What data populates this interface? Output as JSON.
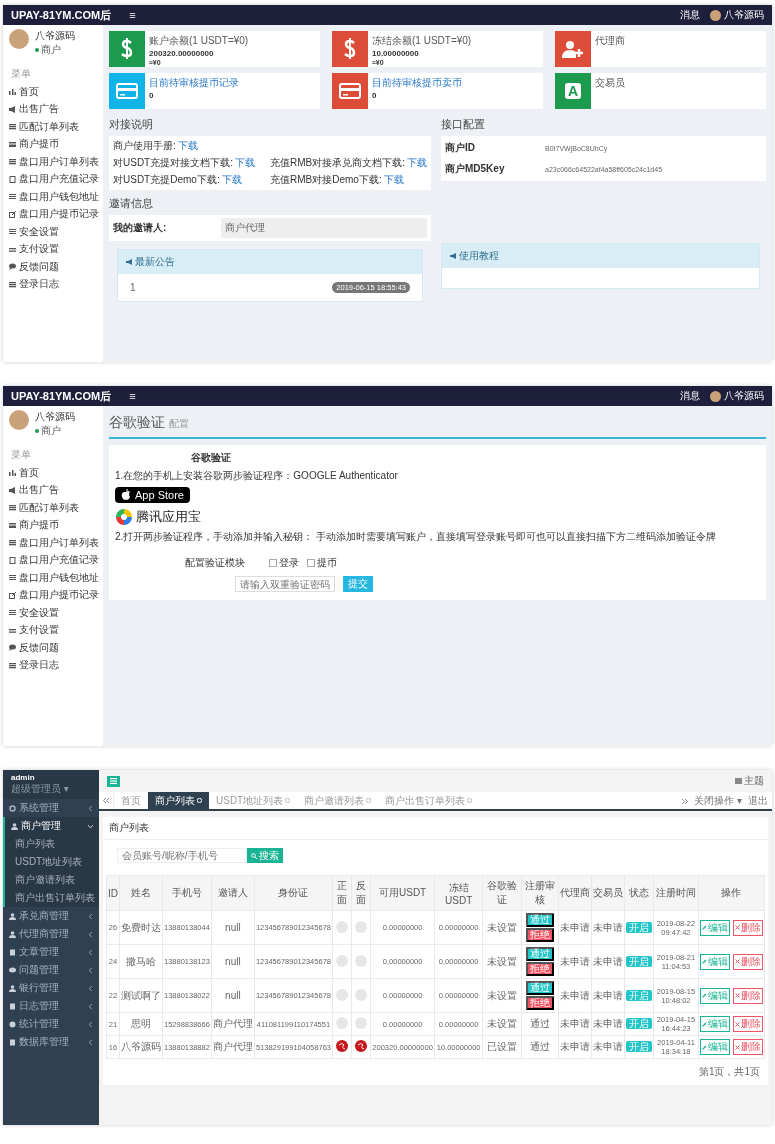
{
  "dashboard": {
    "topbar": {
      "brand": "UPAY-81YM.COM后",
      "menu_glyph": "≡",
      "messages": "消息",
      "user": "八爷源码"
    },
    "sidebar": {
      "user_name": "八爷源码",
      "user_role": "商户",
      "section": "菜单",
      "items": [
        {
          "label": "首页"
        },
        {
          "label": "出售广告"
        },
        {
          "label": "匹配订单列表"
        },
        {
          "label": "商户提币"
        },
        {
          "label": "盘口用户订单列表"
        },
        {
          "label": "盘口用户充值记录"
        },
        {
          "label": "盘口用户钱包地址"
        },
        {
          "label": "盘口用户提币记录"
        },
        {
          "label": "安全设置"
        },
        {
          "label": "支付设置"
        },
        {
          "label": "反馈问题"
        },
        {
          "label": "登录日志"
        }
      ]
    },
    "stat_cards": [
      {
        "kind": "dollar",
        "color": "#1c9a4e",
        "label": "账户余额(1 USDT=¥0)",
        "value": "200320.00000000",
        "sub": "≈¥0"
      },
      {
        "kind": "dollar",
        "color": "#dd4b39",
        "label": "冻结余额(1 USDT=¥0)",
        "value": "10.00000000",
        "sub": "≈¥0"
      },
      {
        "kind": "user-add",
        "color": "#dd4b39",
        "label": "代理商"
      },
      {
        "kind": "card",
        "color": "#10b4e6",
        "label": "目前待审核提币记录",
        "value": "0"
      },
      {
        "kind": "card",
        "color": "#dd4b39",
        "label": "目前待审核提币卖币",
        "value": "0"
      },
      {
        "kind": "letter",
        "color": "#1c9a4e",
        "glyph": "A",
        "label": "交易员"
      }
    ],
    "integration": {
      "title": "对接说明",
      "rows": [
        {
          "cells": [
            {
              "label": "商户使用手册:",
              "link": "下载"
            }
          ]
        },
        {
          "cells": [
            {
              "label": "对USDT充提对接文档下载:",
              "link": "下载"
            },
            {
              "label": "充值RMB对接承兑商文档下载:",
              "link": "下载"
            }
          ]
        },
        {
          "cells": [
            {
              "label": "对USDT充提Demo下载:",
              "link": "下载"
            },
            {
              "label": "充值RMB对接Demo下载:",
              "link": "下载"
            }
          ]
        }
      ]
    },
    "invite": {
      "title": "邀请信息",
      "label": "我的邀请人:",
      "value": "商户代理"
    },
    "api_config": {
      "title": "接口配置",
      "rows": [
        {
          "label": "商户ID",
          "value": "B0I7VWjBoC8UhCy"
        },
        {
          "label": "商户MD5Key",
          "value": "a23c066c64522af4a58ff605c24c1d45"
        }
      ]
    },
    "notice": {
      "title": "最新公告",
      "items": [
        {
          "text": "1",
          "date": "2019-06-15 18:55:43"
        }
      ]
    },
    "tutorial": {
      "title": "使用教程"
    }
  },
  "google_auth": {
    "topbar": {
      "brand": "UPAY-81YM.COM后",
      "menu_glyph": "≡",
      "messages": "消息",
      "user": "八爷源码"
    },
    "sidebar": {
      "user_name": "八爷源码",
      "user_role": "商户",
      "section": "菜单",
      "items": [
        {
          "label": "首页"
        },
        {
          "label": "出售广告"
        },
        {
          "label": "匹配订单列表"
        },
        {
          "label": "商户提币"
        },
        {
          "label": "盘口用户订单列表"
        },
        {
          "label": "盘口用户充值记录"
        },
        {
          "label": "盘口用户钱包地址"
        },
        {
          "label": "盘口用户提币记录"
        },
        {
          "label": "安全设置"
        },
        {
          "label": "支付设置"
        },
        {
          "label": "反馈问题"
        },
        {
          "label": "登录日志"
        }
      ]
    },
    "title": "谷歌验证",
    "subtitle": "配置",
    "heading": "谷歌验证",
    "step1": "1.在您的手机上安装谷歌两步验证程序：GOOGLE Authenticator",
    "app_store": "App Store",
    "tencent": "腾讯应用宝",
    "step2": "2.打开两步验证程序，手动添加并输入秘钥：  手动添加时需要填写账户，直接填写登录账号即可也可以直接扫描下方二维码添加验证令牌",
    "module_label": "配置验证模块",
    "options": [
      {
        "label": "登录",
        "checked": false
      },
      {
        "label": "提币",
        "checked": false
      }
    ],
    "code_field": {
      "placeholder": "请输入双重验证密码"
    },
    "submit": "提交"
  },
  "user_list": {
    "sidebar": {
      "user_name": "admin",
      "user_role": "超级管理员 ▾",
      "items": [
        {
          "label": "系统管理",
          "expanded": false
        },
        {
          "label": "商户管理",
          "expanded": true,
          "children": [
            {
              "label": "商户列表"
            },
            {
              "label": "USDT地址列表"
            },
            {
              "label": "商户邀请列表"
            },
            {
              "label": "商户出售订单列表"
            }
          ]
        },
        {
          "label": "承兑商管理",
          "expanded": false
        },
        {
          "label": "代理商管理",
          "expanded": false
        },
        {
          "label": "文章管理",
          "expanded": false
        },
        {
          "label": "问题管理",
          "expanded": false
        },
        {
          "label": "银行管理",
          "expanded": false
        },
        {
          "label": "日志管理",
          "expanded": false
        },
        {
          "label": "统计管理",
          "expanded": false
        },
        {
          "label": "数据库管理",
          "expanded": false
        }
      ]
    },
    "header": {
      "theme": "主题"
    },
    "tabs": [
      {
        "label": "首页",
        "selected": false
      },
      {
        "label": "商户列表",
        "selected": true
      },
      {
        "label": "USDT地址列表",
        "selected": false
      },
      {
        "label": "商户邀请列表",
        "selected": false
      },
      {
        "label": "商户出售订单列表",
        "selected": false
      }
    ],
    "tab_tools": {
      "close_ops": "关闭操作 ▾",
      "logout": "退出"
    },
    "panel_title": "商户列表",
    "search": {
      "placeholder": "会员账号/昵称/手机号",
      "button": "搜索"
    },
    "table": {
      "columns": [
        "ID",
        "姓名",
        "手机号",
        "邀请人",
        "身份证",
        "正面",
        "反面",
        "可用USDT",
        "冻结USDT",
        "谷歌验证",
        "注册审核",
        "代理商",
        "交易员",
        "状态",
        "注册时间",
        "操作"
      ],
      "rows": [
        {
          "id": "26",
          "name": "免费时达",
          "phone": "13880138044",
          "inviter": "null",
          "id_card": "123456789012345678",
          "front_uploaded": false,
          "back_uploaded": false,
          "usdt": "0.00000000",
          "frozen": "0.00000000",
          "google": "未设置",
          "review": {
            "kind": "buttons",
            "labels": [
              "通过",
              "拒绝"
            ]
          },
          "agent": "未申请",
          "trader": "未申请",
          "status": "开启",
          "time": "2019-08-22 09:47:42",
          "actions": [
            "编辑",
            "删除"
          ]
        },
        {
          "id": "24",
          "name": "撒马哈",
          "phone": "13880138123",
          "inviter": "null",
          "id_card": "123456789012345678",
          "front_uploaded": false,
          "back_uploaded": false,
          "usdt": "0.00000000",
          "frozen": "0.00000000",
          "google": "未设置",
          "review": {
            "kind": "buttons",
            "labels": [
              "通过",
              "拒绝"
            ]
          },
          "agent": "未申请",
          "trader": "未申请",
          "status": "开启",
          "time": "2019-08-21 11:04:53",
          "actions": [
            "编辑",
            "删除"
          ]
        },
        {
          "id": "22",
          "name": "测试啊了",
          "phone": "13880138022",
          "inviter": "null",
          "id_card": "123456789012345678",
          "front_uploaded": false,
          "back_uploaded": false,
          "usdt": "0.00000000",
          "frozen": "0.00000000",
          "google": "未设置",
          "review": {
            "kind": "buttons",
            "labels": [
              "通过",
              "拒绝"
            ]
          },
          "agent": "未申请",
          "trader": "未申请",
          "status": "开启",
          "time": "2019-08-15 10:48:02",
          "actions": [
            "编辑",
            "删除"
          ]
        },
        {
          "id": "21",
          "name": "思明",
          "phone": "15298838666",
          "inviter": "商户代理",
          "id_card": "411081199110174551",
          "front_uploaded": false,
          "back_uploaded": false,
          "usdt": "0.00000000",
          "frozen": "0.00000000",
          "google": "未设置",
          "review": {
            "kind": "text",
            "text": "通过"
          },
          "agent": "未申请",
          "trader": "未申请",
          "status": "开启",
          "time": "2019-04-15 16:44:23",
          "actions": [
            "编辑",
            "删除"
          ]
        },
        {
          "id": "16",
          "name": "八爷源码",
          "phone": "13880138882",
          "inviter": "商户代理",
          "id_card": "513829199104058763",
          "front_uploaded": true,
          "back_uploaded": true,
          "usdt": "200320.00000000",
          "frozen": "10.00000000",
          "google": "已设置",
          "review": {
            "kind": "text",
            "text": "通过"
          },
          "agent": "未申请",
          "trader": "未申请",
          "status": "开启",
          "time": "2019-04-11 18:34:18",
          "actions": [
            "编辑",
            "删除"
          ]
        }
      ]
    },
    "pagination": "第1页，共1页"
  }
}
